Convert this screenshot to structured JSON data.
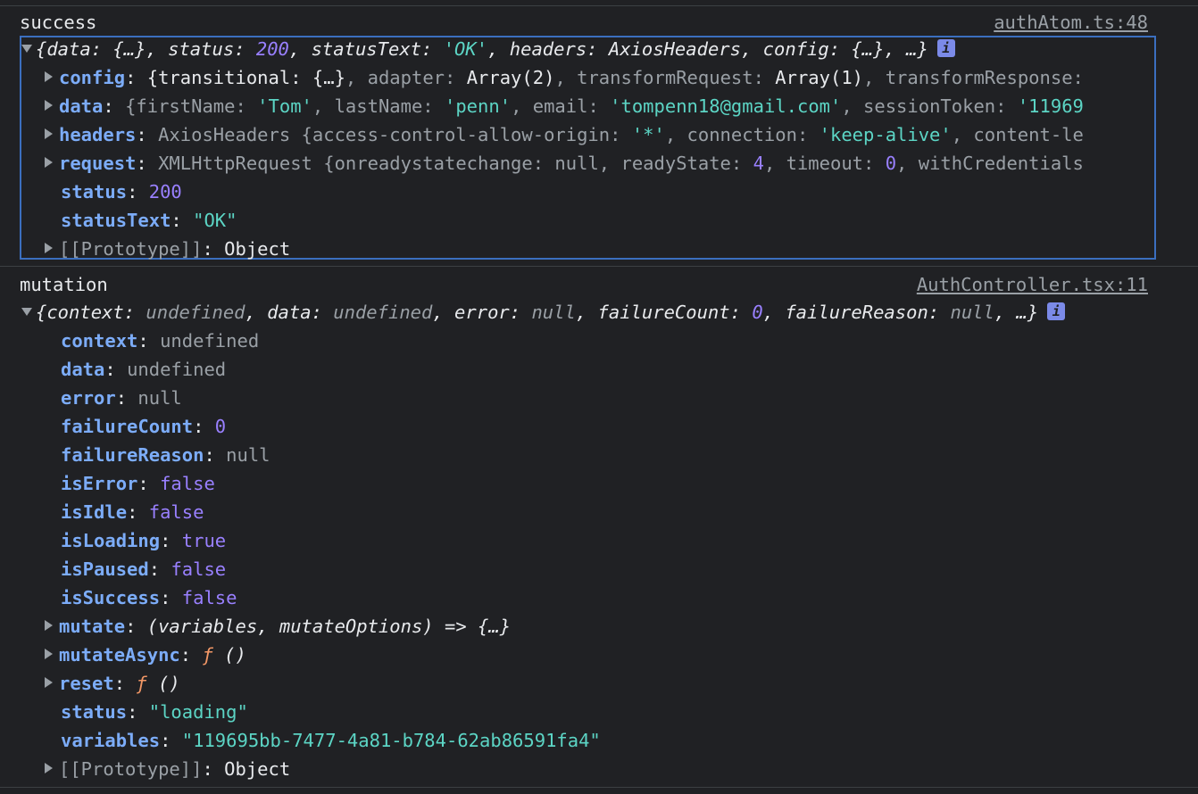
{
  "groups": [
    {
      "label": "success",
      "source": "authAtom.ts:48",
      "summary": {
        "keys": [
          "data",
          "status",
          "statusText",
          "headers",
          "config"
        ],
        "data_val": "{…}",
        "status_val": "200",
        "statusText_val": "'OK'",
        "headers_val": "AxiosHeaders",
        "config_val": "{…}",
        "tail": ", …}"
      },
      "rows": [
        {
          "key": "config",
          "value_parts": [
            "{transitional: ",
            "{…}",
            ", adapter: ",
            "Array(2)",
            ", transformRequest: ",
            "Array(1)",
            ", transformResponse:"
          ]
        },
        {
          "key": "data",
          "value_parts": [
            "{firstName: ",
            "'Tom'",
            ", lastName: ",
            "'penn'",
            ", email: ",
            "'tompenn18@gmail.com'",
            ", sessionToken: ",
            "'11969"
          ]
        },
        {
          "key": "headers",
          "value_parts": [
            "AxiosHeaders {access-control-allow-origin: ",
            "'*'",
            ", connection: ",
            "'keep-alive'",
            ", content-le"
          ]
        },
        {
          "key": "request",
          "value_parts": [
            "XMLHttpRequest {onreadystatechange: ",
            "null",
            ", readyState: ",
            "4",
            ", timeout: ",
            "0",
            ", withCredentials"
          ]
        },
        {
          "key": "status",
          "value": "200"
        },
        {
          "key": "statusText",
          "value": "\"OK\""
        },
        {
          "key": "[[Prototype]]",
          "value": "Object"
        }
      ]
    },
    {
      "label": "mutation",
      "source": "AuthController.tsx:11",
      "summary": {
        "context_val": "undefined",
        "data_val": "undefined",
        "error_val": "null",
        "failureCount_val": "0",
        "failureReason_val": "null",
        "tail": ", …}"
      },
      "rows": [
        {
          "key": "context",
          "value": "undefined"
        },
        {
          "key": "data",
          "value": "undefined"
        },
        {
          "key": "error",
          "value": "null"
        },
        {
          "key": "failureCount",
          "value": "0"
        },
        {
          "key": "failureReason",
          "value": "null"
        },
        {
          "key": "isError",
          "value": "false"
        },
        {
          "key": "isIdle",
          "value": "false"
        },
        {
          "key": "isLoading",
          "value": "true"
        },
        {
          "key": "isPaused",
          "value": "false"
        },
        {
          "key": "isSuccess",
          "value": "false"
        },
        {
          "key": "mutate",
          "value": "(variables, mutateOptions) => {…}"
        },
        {
          "key": "mutateAsync",
          "value_fn": "ƒ",
          "value": "()"
        },
        {
          "key": "reset",
          "value_fn": "ƒ",
          "value": "()"
        },
        {
          "key": "status",
          "value": "\"loading\""
        },
        {
          "key": "variables",
          "value": "\"119695bb-7477-4a81-b784-62ab86591fa4\""
        },
        {
          "key": "[[Prototype]]",
          "value": "Object"
        }
      ]
    }
  ],
  "icons": {
    "info": "i",
    "expand": "triangle-right",
    "collapse": "triangle-down"
  },
  "colors": {
    "bg": "#202124",
    "key": "#7cacf8",
    "string": "#5cd5c5",
    "number": "#9980ff",
    "null": "#9aa0a6",
    "function": "#f29766",
    "selection": "#3b6fbf"
  }
}
